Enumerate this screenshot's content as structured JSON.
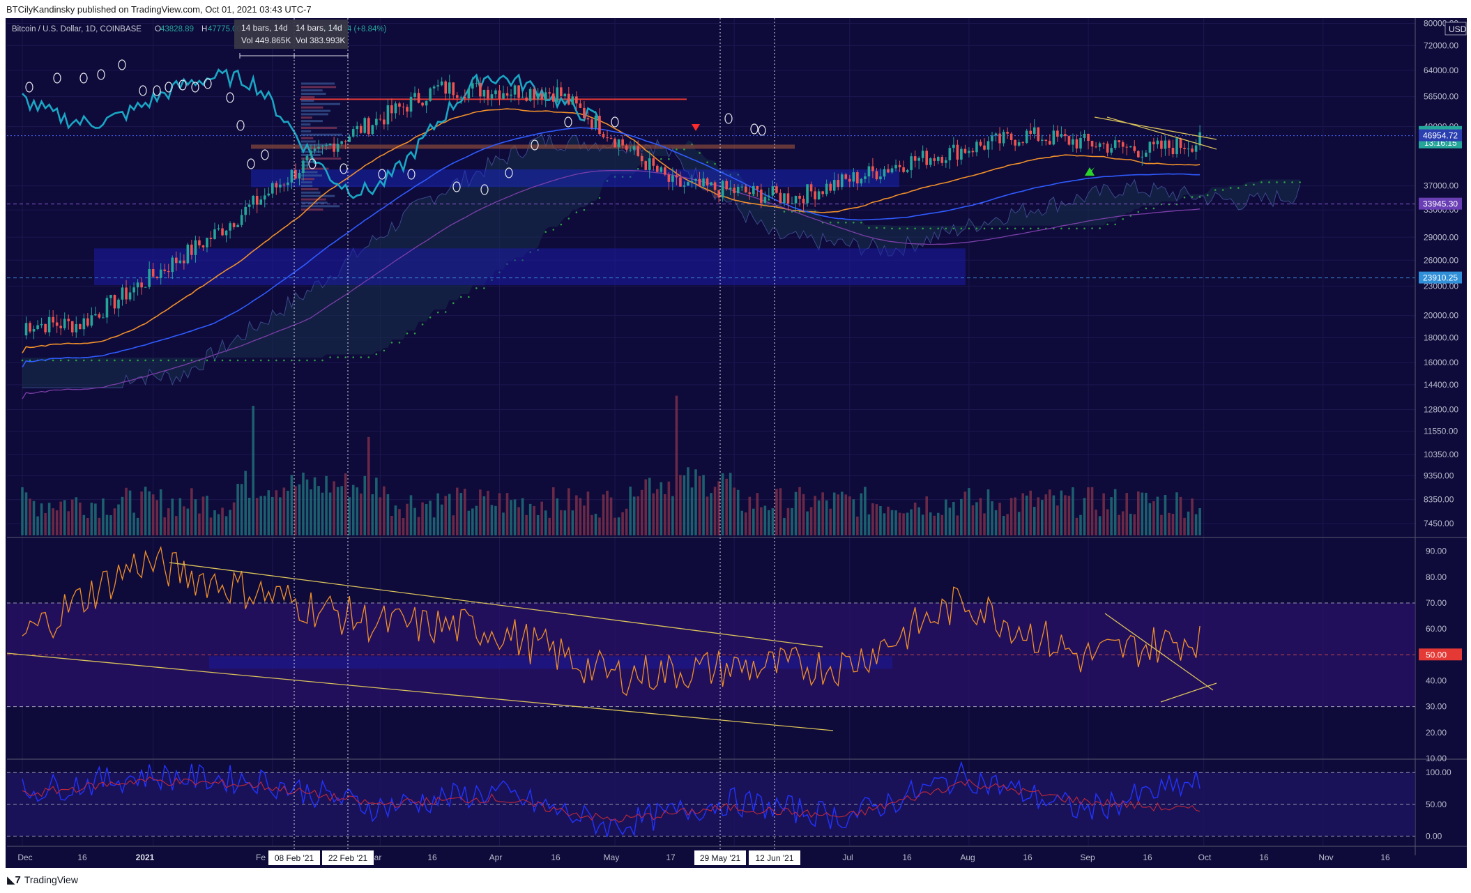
{
  "publisher_line": "BTCilyKandinsky published on TradingView.com, Oct 01, 2021 03:43 UTC-7",
  "footer_brand": "TradingView",
  "symbol": {
    "title": "Bitcoin / U.S. Dollar, 1D, COINBASE",
    "open_label": "O",
    "open": "43828.89",
    "high_label": "H",
    "high": "47775.00",
    "change": "+3869.14 (+8.84%)"
  },
  "measure_tooltip": {
    "bars_left": "14 bars, 14d",
    "bars_right": "14 bars, 14d",
    "vol_left": "Vol 449.865K",
    "vol_right": "Vol 383.993K"
  },
  "currency": "USD",
  "colors": {
    "background": "#0e0a3a",
    "up": "#26a69a",
    "down": "#ef5350",
    "orange": "#f0902a",
    "cyan": "#1aa6c4",
    "blue": "#2f5cff",
    "purple": "#7b3fa8",
    "rsi_band": "#2a1268",
    "trend": "#d9c25a",
    "green_dots": "#2ea043",
    "text_axis": "#b8bccc"
  },
  "price_axis_ticks": [
    "80000.00",
    "72000.00",
    "64000.00",
    "56500.00",
    "49000.00",
    "37000.00",
    "33000.00",
    "29000.00",
    "26000.00",
    "23000.00",
    "20000.00",
    "18000.00",
    "16000.00",
    "14400.00",
    "12800.00",
    "11550.00",
    "10350.00",
    "9350.00",
    "8350.00",
    "7450.00"
  ],
  "price_labels": [
    {
      "text": "47698.57",
      "sub": "13:16:15",
      "color": "#26a69a"
    },
    {
      "text": "46954.72",
      "color": "#2a3fb0"
    },
    {
      "text": "33945.30",
      "color": "#6a3fb5"
    },
    {
      "text": "23910.25",
      "color": "#2f8fd8"
    }
  ],
  "rsi_axis_ticks": [
    "90.00",
    "80.00",
    "70.00",
    "60.00",
    "50.00",
    "40.00",
    "30.00",
    "20.00",
    "10.00"
  ],
  "rsi_highlight": "50.00",
  "stoch_axis_ticks": [
    "100.00",
    "50.00",
    "0.00"
  ],
  "time_axis": [
    "Dec",
    "16",
    "2021",
    "Fe",
    "Mar",
    "16",
    "Apr",
    "16",
    "May",
    "17",
    "Jul",
    "16",
    "Aug",
    "16",
    "Sep",
    "16",
    "Oct",
    "16",
    "Nov",
    "16"
  ],
  "time_markers": [
    "08 Feb '21",
    "22 Feb '21",
    "29 May '21",
    "12 Jun '21"
  ],
  "chart_data": [
    {
      "type": "candlestick",
      "title": "Bitcoin / U.S. Dollar, 1D, COINBASE",
      "yscale": "log",
      "ylim": [
        7000,
        82000
      ],
      "x": [
        "Dec '20",
        "Jan '21",
        "Feb '21",
        "Mar '21",
        "Apr '21",
        "May '21",
        "Jun '21",
        "Jul '21",
        "Aug '21",
        "Sep '21",
        "Oct '21"
      ],
      "close": [
        19200,
        29000,
        45000,
        58800,
        57700,
        37300,
        35000,
        41500,
        47100,
        43800,
        47700
      ],
      "last": {
        "open": 43828.89,
        "high": 47775.0,
        "close": 47698.57
      },
      "levels": [
        33945.3,
        23910.25,
        46954.72
      ],
      "grid": true,
      "volume": true
    },
    {
      "type": "line",
      "title": "RSI",
      "ylim": [
        10,
        95
      ],
      "x": [
        "Dec '20",
        "Jan '21",
        "Feb '21",
        "Mar '21",
        "Apr '21",
        "May '21",
        "Jun '21",
        "Jul '21",
        "Aug '21",
        "Sep '21",
        "Oct '21"
      ],
      "series": [
        {
          "values": [
            57,
            86,
            74,
            62,
            60,
            42,
            45,
            46,
            71,
            49,
            57
          ]
        }
      ],
      "bands": [
        30,
        50,
        70
      ]
    },
    {
      "type": "line",
      "title": "Stoch RSI",
      "ylim": [
        -15,
        120
      ],
      "x": [
        "Dec '20",
        "Jan '21",
        "Feb '21",
        "Mar '21",
        "Apr '21",
        "May '21",
        "Jun '21",
        "Jul '21",
        "Aug '21",
        "Sep '21",
        "Oct '21"
      ],
      "series": [
        {
          "values": [
            70,
            95,
            88,
            45,
            70,
            15,
            55,
            30,
            95,
            40,
            85
          ]
        },
        {
          "values": [
            65,
            88,
            80,
            50,
            60,
            25,
            45,
            30,
            85,
            55,
            40
          ]
        }
      ],
      "bands": [
        0,
        50,
        100
      ]
    }
  ]
}
